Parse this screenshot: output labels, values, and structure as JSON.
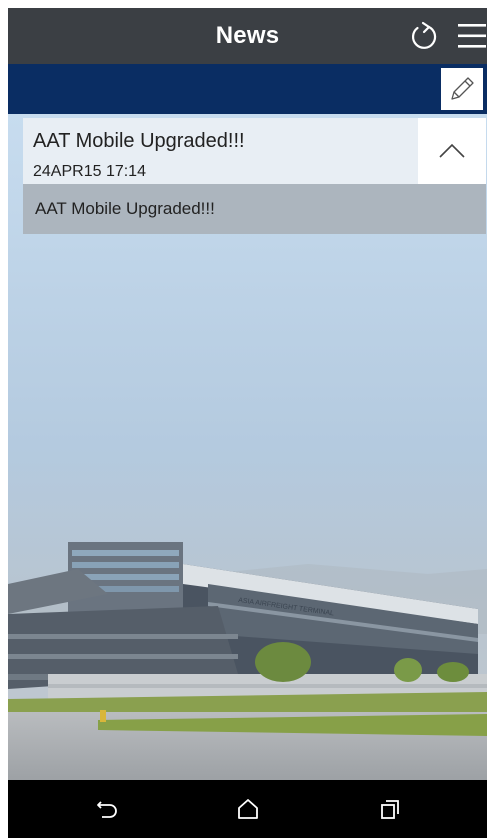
{
  "header": {
    "title": "News",
    "refresh_icon": "refresh-icon",
    "menu_icon": "menu-icon"
  },
  "toolbar": {
    "edit_icon": "pencil-icon"
  },
  "news": {
    "items": [
      {
        "title": "AAT Mobile Upgraded!!!",
        "date": "24APR15 17:14",
        "body": "AAT Mobile Upgraded!!!",
        "expanded": true
      }
    ]
  },
  "background": {
    "building_sign": "ASIA AIRFREIGHT TERMINAL"
  },
  "navbar": {
    "back_icon": "back-icon",
    "home_icon": "home-icon",
    "recent_icon": "recent-apps-icon"
  },
  "colors": {
    "appbar": "#3b3f44",
    "subbar": "#0a2d63",
    "navbar": "#000000"
  }
}
